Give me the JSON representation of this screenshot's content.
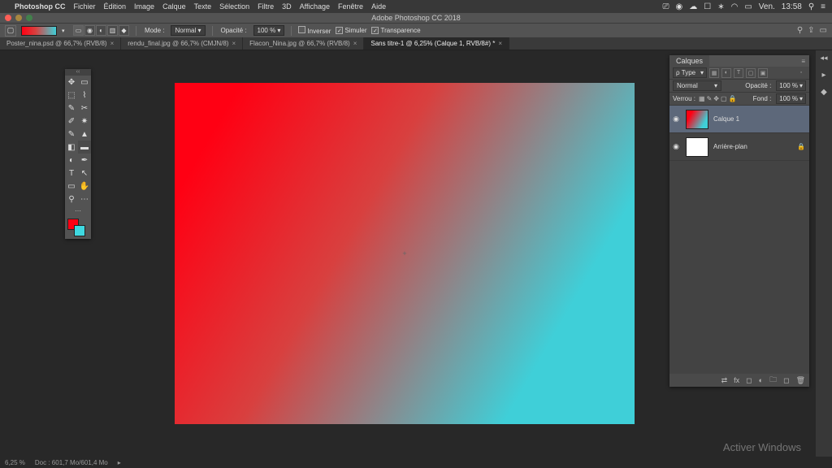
{
  "macmenu": {
    "app": "Photoshop CC",
    "items": [
      "Fichier",
      "Édition",
      "Image",
      "Calque",
      "Texte",
      "Sélection",
      "Filtre",
      "3D",
      "Affichage",
      "Fenêtre",
      "Aide"
    ],
    "right": {
      "day": "Ven.",
      "time": "13:58"
    }
  },
  "window": {
    "title": "Adobe Photoshop CC 2018"
  },
  "options": {
    "mode_label": "Mode :",
    "mode_value": "Normal",
    "opacity_label": "Opacité :",
    "opacity_value": "100 %",
    "inverser": "Inverser",
    "simuler": "Simuler",
    "transparence": "Transparence"
  },
  "tabs": [
    {
      "label": "Poster_nina.psd @ 66,7% (RVB/8)",
      "active": false
    },
    {
      "label": "rendu_final.jpg @ 66,7% (CMJN/8)",
      "active": false
    },
    {
      "label": "Flacon_Nina.jpg @ 66,7% (RVB/8)",
      "active": false
    },
    {
      "label": "Sans titre-1 @ 6,25% (Calque 1, RVB/8#) *",
      "active": true
    }
  ],
  "canvas": {
    "gradient_from": "#ff0013",
    "gradient_to": "#3fd8e0"
  },
  "layers_panel": {
    "tab": "Calques",
    "filter_kind": "ρ Type",
    "blend_mode": "Normal",
    "opacity_label": "Opacité :",
    "opacity_value": "100 %",
    "lock_label": "Verrou :",
    "fill_label": "Fond :",
    "fill_value": "100 %",
    "layers": [
      {
        "name": "Calque 1",
        "thumb": "grad",
        "active": true,
        "locked": false
      },
      {
        "name": "Arrière-plan",
        "thumb": "white",
        "active": false,
        "locked": true
      }
    ]
  },
  "status": {
    "zoom": "6,25 %",
    "doc": "Doc : 601,7 Mo/601,4 Mo"
  },
  "watermark": "Activer Windows"
}
